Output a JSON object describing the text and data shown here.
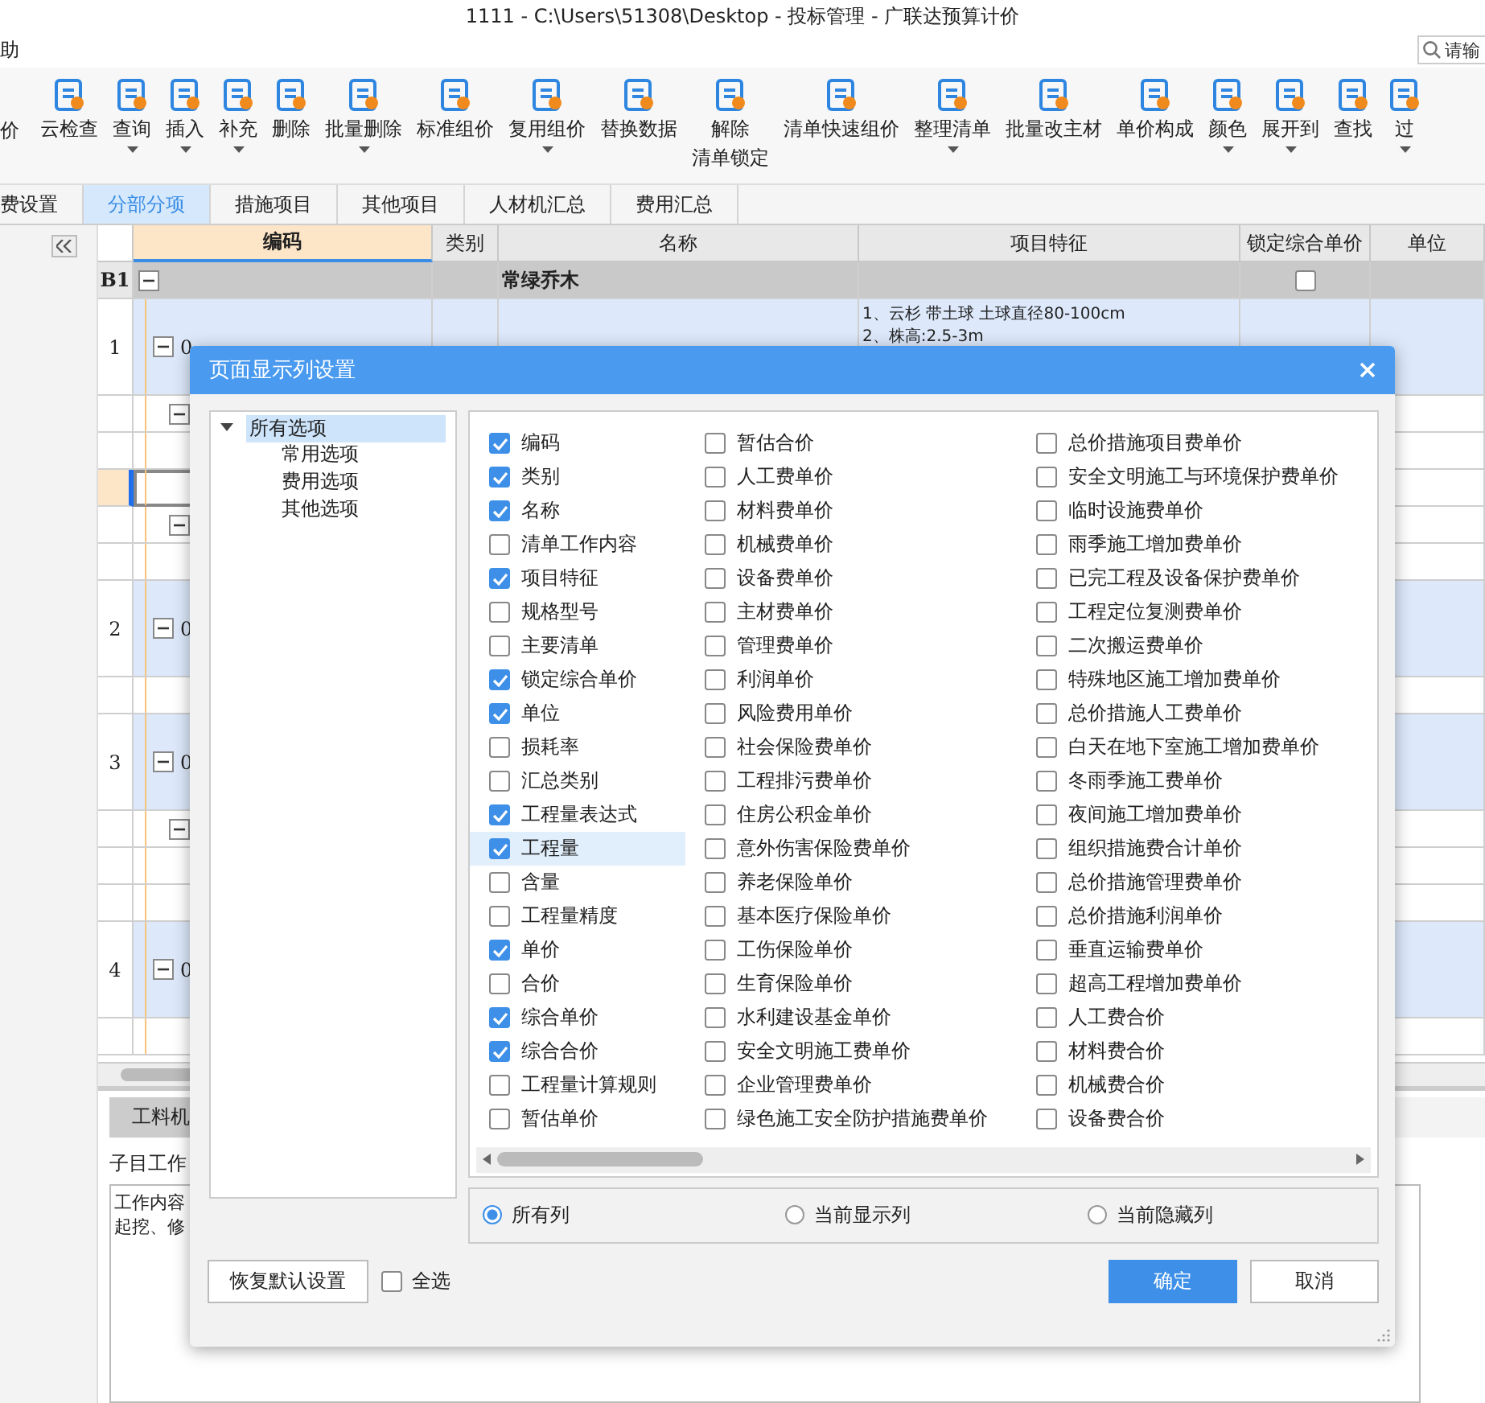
{
  "window": {
    "title": "1111 - C:\\Users\\51308\\Desktop - 投标管理 - 广联达预算计价"
  },
  "menu": {
    "items": [
      "助"
    ],
    "search": {
      "placeholder": "请输"
    }
  },
  "toolbar": [
    {
      "label": "价",
      "dropdown": false
    },
    {
      "label": "云检查",
      "dropdown": false
    },
    {
      "label": "查询",
      "dropdown": true
    },
    {
      "label": "插入",
      "dropdown": true
    },
    {
      "label": "补充",
      "dropdown": true
    },
    {
      "label": "删除",
      "dropdown": false
    },
    {
      "label": "批量删除",
      "dropdown": true
    },
    {
      "label": "标准组价",
      "dropdown": false
    },
    {
      "label": "复用组价",
      "dropdown": true
    },
    {
      "label": "替换数据",
      "dropdown": false
    },
    {
      "lines": [
        "解除",
        "清单锁定"
      ],
      "dropdown": false
    },
    {
      "label": "清单快速组价",
      "dropdown": false
    },
    {
      "label": "整理清单",
      "dropdown": true
    },
    {
      "label": "批量改主材",
      "dropdown": false
    },
    {
      "label": "单价构成",
      "dropdown": false
    },
    {
      "label": "颜色",
      "dropdown": true
    },
    {
      "label": "展开到",
      "dropdown": true
    },
    {
      "label": "查找",
      "dropdown": false
    },
    {
      "label": "过",
      "dropdown": true
    }
  ],
  "tabs": [
    {
      "label": "费设置",
      "selected": false
    },
    {
      "label": "分部分项",
      "selected": true
    },
    {
      "label": "措施项目",
      "selected": false
    },
    {
      "label": "其他项目",
      "selected": false
    },
    {
      "label": "人材机汇总",
      "selected": false
    },
    {
      "label": "费用汇总",
      "selected": false
    }
  ],
  "table": {
    "columns": [
      "编码",
      "类别",
      "名称",
      "项目特征",
      "锁定综合单价",
      "单位"
    ],
    "rows": [
      {
        "kind": "group",
        "num": "B1",
        "name": "常绿乔木",
        "expanded": true,
        "locked": false
      },
      {
        "kind": "item",
        "num": "1",
        "code": "0",
        "expanded": true,
        "features": [
          "1、云杉  带土球 土球直径80-100cm",
          "2、株高:2.5-3m"
        ]
      },
      {
        "kind": "sub",
        "expanded": true,
        "selected": false
      },
      {
        "kind": "leaf",
        "selected": false
      },
      {
        "kind": "leaf",
        "selected": true
      },
      {
        "kind": "sub",
        "expanded": true,
        "selected": false
      },
      {
        "kind": "leaf",
        "selected": false
      },
      {
        "kind": "item",
        "num": "2",
        "code": "0",
        "expanded": true
      },
      {
        "kind": "leaf",
        "selected": false
      },
      {
        "kind": "item",
        "num": "3",
        "code": "0",
        "expanded": true
      },
      {
        "kind": "sub",
        "expanded": true,
        "selected": false
      },
      {
        "kind": "leaf",
        "selected": false
      },
      {
        "kind": "leaf",
        "selected": false
      },
      {
        "kind": "item",
        "num": "4",
        "code": "0",
        "expanded": true
      },
      {
        "kind": "leaf",
        "selected": false
      }
    ]
  },
  "bottom_panel": {
    "tab": "工料机",
    "label": "子目工作",
    "content": [
      "工作内容",
      "起挖、修"
    ]
  },
  "dialog": {
    "title": "页面显示列设置",
    "tree": {
      "label": "所有选项",
      "expanded": true,
      "selected": true,
      "children": [
        {
          "label": "常用选项",
          "selected": false
        },
        {
          "label": "费用选项",
          "selected": false
        },
        {
          "label": "其他选项",
          "selected": false
        }
      ]
    },
    "columns": [
      {
        "label": "编码",
        "checked": true,
        "selected": false
      },
      {
        "label": "类别",
        "checked": true,
        "selected": false
      },
      {
        "label": "名称",
        "checked": true,
        "selected": false
      },
      {
        "label": "清单工作内容",
        "checked": false,
        "selected": false
      },
      {
        "label": "项目特征",
        "checked": true,
        "selected": false
      },
      {
        "label": "规格型号",
        "checked": false,
        "selected": false
      },
      {
        "label": "主要清单",
        "checked": false,
        "selected": false
      },
      {
        "label": "锁定综合单价",
        "checked": true,
        "selected": false
      },
      {
        "label": "单位",
        "checked": true,
        "selected": false
      },
      {
        "label": "损耗率",
        "checked": false,
        "selected": false
      },
      {
        "label": "汇总类别",
        "checked": false,
        "selected": false
      },
      {
        "label": "工程量表达式",
        "checked": true,
        "selected": false
      },
      {
        "label": "工程量",
        "checked": true,
        "selected": true
      },
      {
        "label": "含量",
        "checked": false,
        "selected": false
      },
      {
        "label": "工程量精度",
        "checked": false,
        "selected": false
      },
      {
        "label": "单价",
        "checked": true,
        "selected": false
      },
      {
        "label": "合价",
        "checked": false,
        "selected": false
      },
      {
        "label": "综合单价",
        "checked": true,
        "selected": false
      },
      {
        "label": "综合合价",
        "checked": true,
        "selected": false
      },
      {
        "label": "工程量计算规则",
        "checked": false,
        "selected": false
      },
      {
        "label": "暂估单价",
        "checked": false,
        "selected": false
      },
      {
        "label": "暂估合价",
        "checked": false,
        "selected": false
      },
      {
        "label": "人工费单价",
        "checked": false,
        "selected": false
      },
      {
        "label": "材料费单价",
        "checked": false,
        "selected": false
      },
      {
        "label": "机械费单价",
        "checked": false,
        "selected": false
      },
      {
        "label": "设备费单价",
        "checked": false,
        "selected": false
      },
      {
        "label": "主材费单价",
        "checked": false,
        "selected": false
      },
      {
        "label": "管理费单价",
        "checked": false,
        "selected": false
      },
      {
        "label": "利润单价",
        "checked": false,
        "selected": false
      },
      {
        "label": "风险费用单价",
        "checked": false,
        "selected": false
      },
      {
        "label": "社会保险费单价",
        "checked": false,
        "selected": false
      },
      {
        "label": "工程排污费单价",
        "checked": false,
        "selected": false
      },
      {
        "label": "住房公积金单价",
        "checked": false,
        "selected": false
      },
      {
        "label": "意外伤害保险费单价",
        "checked": false,
        "selected": false
      },
      {
        "label": "养老保险单价",
        "checked": false,
        "selected": false
      },
      {
        "label": "基本医疗保险单价",
        "checked": false,
        "selected": false
      },
      {
        "label": "工伤保险单价",
        "checked": false,
        "selected": false
      },
      {
        "label": "生育保险单价",
        "checked": false,
        "selected": false
      },
      {
        "label": "水利建设基金单价",
        "checked": false,
        "selected": false
      },
      {
        "label": "安全文明施工费单价",
        "checked": false,
        "selected": false
      },
      {
        "label": "企业管理费单价",
        "checked": false,
        "selected": false
      },
      {
        "label": "绿色施工安全防护措施费单价",
        "checked": false,
        "selected": false
      },
      {
        "label": "总价措施项目费单价",
        "checked": false,
        "selected": false
      },
      {
        "label": "安全文明施工与环境保护费单价",
        "checked": false,
        "selected": false
      },
      {
        "label": "临时设施费单价",
        "checked": false,
        "selected": false
      },
      {
        "label": "雨季施工增加费单价",
        "checked": false,
        "selected": false
      },
      {
        "label": "已完工程及设备保护费单价",
        "checked": false,
        "selected": false
      },
      {
        "label": "工程定位复测费单价",
        "checked": false,
        "selected": false
      },
      {
        "label": "二次搬运费单价",
        "checked": false,
        "selected": false
      },
      {
        "label": "特殊地区施工增加费单价",
        "checked": false,
        "selected": false
      },
      {
        "label": "总价措施人工费单价",
        "checked": false,
        "selected": false
      },
      {
        "label": "白天在地下室施工增加费单价",
        "checked": false,
        "selected": false
      },
      {
        "label": "冬雨季施工费单价",
        "checked": false,
        "selected": false
      },
      {
        "label": "夜间施工增加费单价",
        "checked": false,
        "selected": false
      },
      {
        "label": "组织措施费合计单价",
        "checked": false,
        "selected": false
      },
      {
        "label": "总价措施管理费单价",
        "checked": false,
        "selected": false
      },
      {
        "label": "总价措施利润单价",
        "checked": false,
        "selected": false
      },
      {
        "label": "垂直运输费单价",
        "checked": false,
        "selected": false
      },
      {
        "label": "超高工程增加费单价",
        "checked": false,
        "selected": false
      },
      {
        "label": "人工费合价",
        "checked": false,
        "selected": false
      },
      {
        "label": "材料费合价",
        "checked": false,
        "selected": false
      },
      {
        "label": "机械费合价",
        "checked": false,
        "selected": false
      },
      {
        "label": "设备费合价",
        "checked": false,
        "selected": false
      }
    ],
    "filters": [
      {
        "label": "所有列",
        "selected": true
      },
      {
        "label": "当前显示列",
        "selected": false
      },
      {
        "label": "当前隐藏列",
        "selected": false
      }
    ],
    "reset_button": "恢复默认设置",
    "select_all": {
      "label": "全选",
      "checked": false
    },
    "buttons": [
      {
        "label": "确定",
        "kind": "primary"
      },
      {
        "label": "取消",
        "kind": "secondary"
      }
    ]
  }
}
